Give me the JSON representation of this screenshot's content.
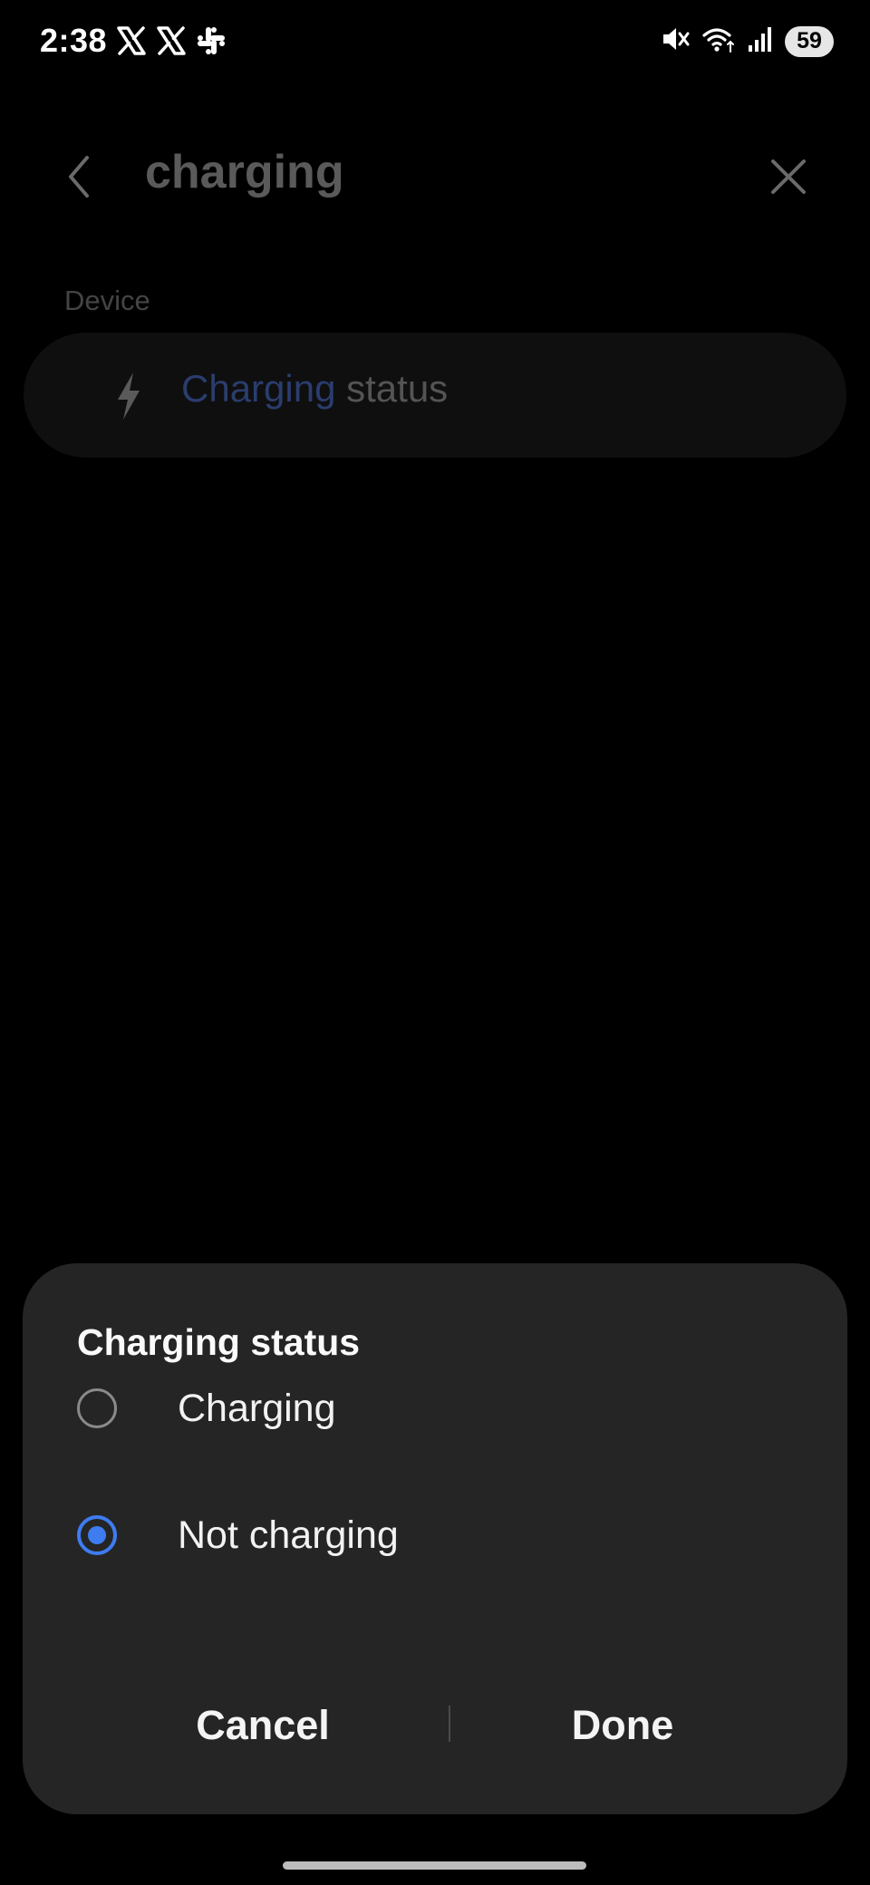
{
  "status_bar": {
    "time": "2:38",
    "battery": "59",
    "left_icons": [
      "x-logo-icon",
      "x-logo-icon",
      "slack-icon"
    ],
    "right_icons": [
      "mute-icon",
      "wifi-icon",
      "signal-icon",
      "battery-icon"
    ]
  },
  "search": {
    "query": "charging"
  },
  "results": {
    "section_label": "Device",
    "items": [
      {
        "icon": "bolt-icon",
        "highlight": "Charging",
        "rest": " status"
      }
    ]
  },
  "dialog": {
    "title": "Charging status",
    "options": [
      {
        "label": "Charging",
        "selected": false
      },
      {
        "label": "Not charging",
        "selected": true
      }
    ],
    "cancel_label": "Cancel",
    "done_label": "Done"
  },
  "colors": {
    "accent": "#3e7cf0",
    "dialog_bg": "#252525",
    "background": "#000000"
  }
}
